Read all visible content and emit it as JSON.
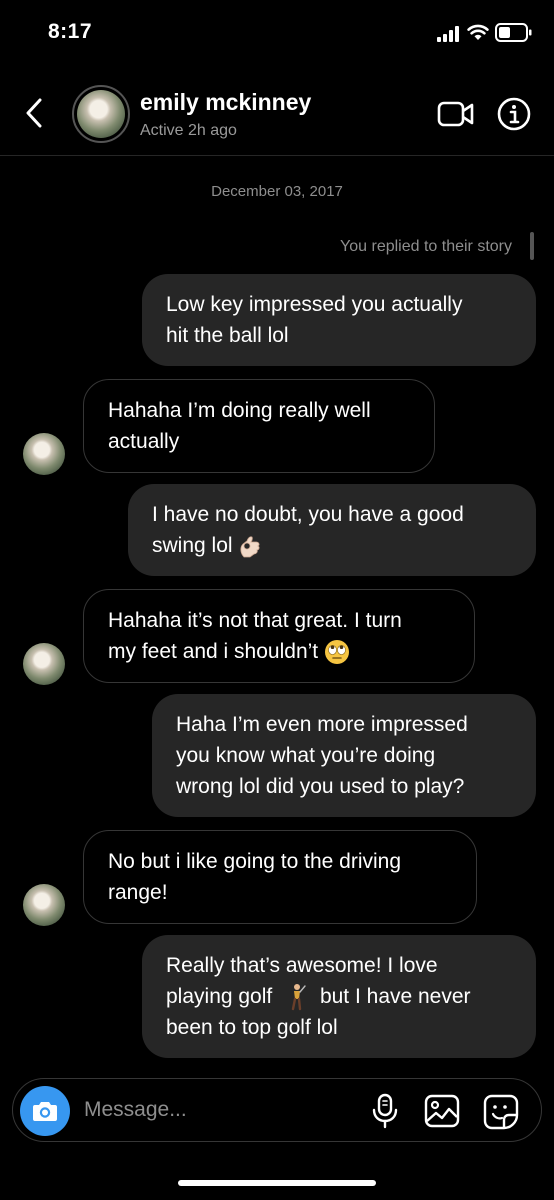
{
  "status": {
    "time": "8:17"
  },
  "header": {
    "name": "emily mckinney",
    "status": "Active 2h ago",
    "icons": [
      "back-chevron-icon",
      "video-camera-icon",
      "info-icon"
    ]
  },
  "conversation": {
    "date": "December 03, 2017",
    "story_reply_note": "You replied to their story",
    "messages": [
      {
        "from": "me",
        "lines": [
          "Low key impressed you actually",
          "hit the ball lol"
        ]
      },
      {
        "from": "them",
        "lines": [
          "Hahaha I’m doing really well",
          "actually"
        ]
      },
      {
        "from": "me",
        "lines": [
          "I have no doubt, you have a good",
          "swing lol"
        ],
        "emoji": "ok-hand"
      },
      {
        "from": "them",
        "lines": [
          "Hahaha it’s not that great. I turn",
          "my feet and i shouldn’t"
        ],
        "emoji": "eye-roll"
      },
      {
        "from": "me",
        "lines": [
          "Haha I’m even more impressed",
          "you know what you’re doing",
          "wrong lol did you used to play?"
        ]
      },
      {
        "from": "them",
        "lines": [
          "No but i like going to the driving",
          "range!"
        ]
      },
      {
        "from": "me",
        "lines": [
          "Really that’s awesome! I love",
          "playing golf",
          "but I have never",
          "been to top golf lol"
        ],
        "emoji": "golfer"
      }
    ]
  },
  "composer": {
    "placeholder": "Message...",
    "icons": [
      "camera-icon",
      "microphone-icon",
      "photo-icon",
      "sticker-icon"
    ],
    "accent": "#3797f0"
  },
  "colors": {
    "outgoing_bubble": "#262626",
    "incoming_border": "#363636",
    "muted_text": "#8e8e8e"
  }
}
